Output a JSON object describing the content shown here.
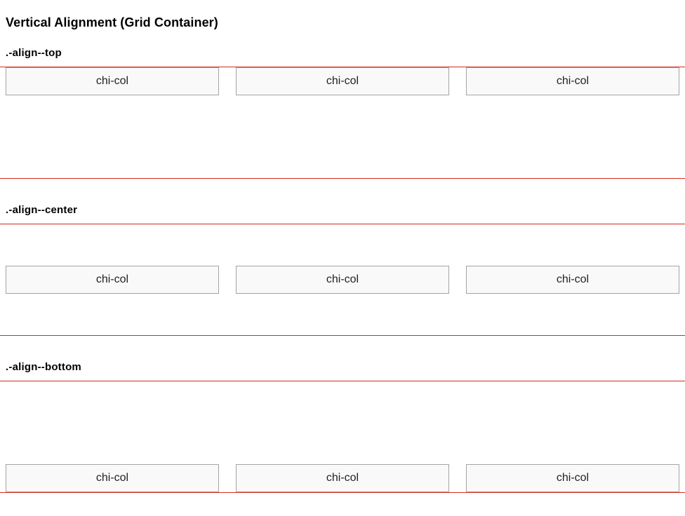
{
  "page": {
    "title": "Vertical Alignment (Grid Container)"
  },
  "sections": [
    {
      "heading": ".-align--top",
      "columns": [
        "chi-col",
        "chi-col",
        "chi-col"
      ]
    },
    {
      "heading": ".-align--center",
      "columns": [
        "chi-col",
        "chi-col",
        "chi-col"
      ]
    },
    {
      "heading": ".-align--bottom",
      "columns": [
        "chi-col",
        "chi-col",
        "chi-col"
      ]
    }
  ],
  "colors": {
    "grid_border": "#d52b1e",
    "col_background": "#f9f9f9",
    "col_border": "#a4a4a4"
  }
}
